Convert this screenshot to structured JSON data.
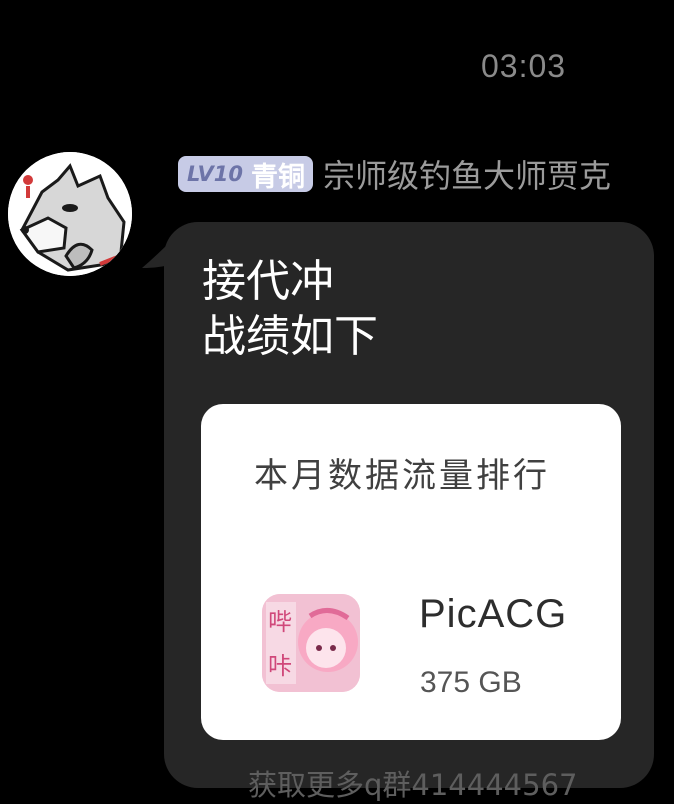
{
  "chat": {
    "timestamp": "03:03",
    "sender": {
      "level_label": "LV10",
      "rank_label": "青铜",
      "name": "宗师级钓鱼大师贾克"
    },
    "message": {
      "lines": [
        "接代冲",
        "战绩如下"
      ]
    },
    "shared_card": {
      "title": "本月数据流量排行",
      "app": {
        "name": "PicACG",
        "usage": "375 GB",
        "icon": "picacg-app-icon"
      }
    }
  },
  "watermark": "获取更多q群414444567",
  "colors": {
    "background": "#000000",
    "bubble": "#262626",
    "badge": "#c7cbe6",
    "card": "#ffffff"
  }
}
